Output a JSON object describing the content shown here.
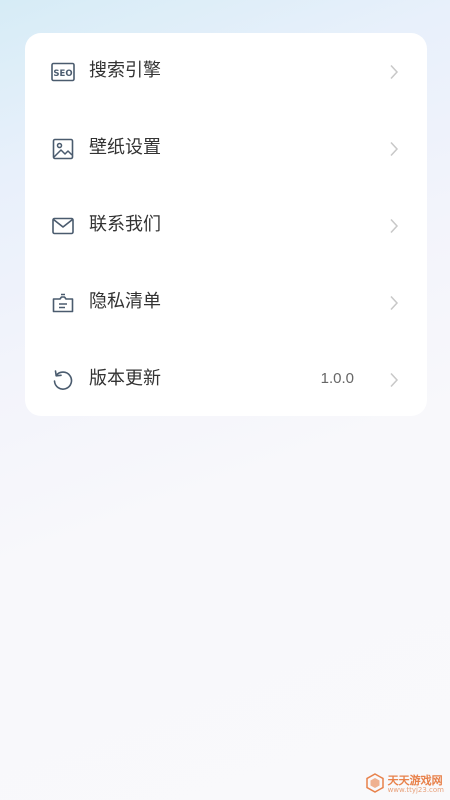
{
  "menu": {
    "items": [
      {
        "label": "搜索引擎",
        "icon": "seo-icon",
        "value": ""
      },
      {
        "label": "壁纸设置",
        "icon": "image-icon",
        "value": ""
      },
      {
        "label": "联系我们",
        "icon": "mail-icon",
        "value": ""
      },
      {
        "label": "隐私清单",
        "icon": "privacy-list-icon",
        "value": ""
      },
      {
        "label": "版本更新",
        "icon": "refresh-icon",
        "value": "1.0.0"
      }
    ]
  },
  "watermark": {
    "brand": "天天游戏网",
    "url": "www.ttyj23.com"
  },
  "colors": {
    "text": "#333333",
    "icon": "#4a5b6e",
    "chevron": "#c8c8c8",
    "watermark": "#e8814a"
  }
}
